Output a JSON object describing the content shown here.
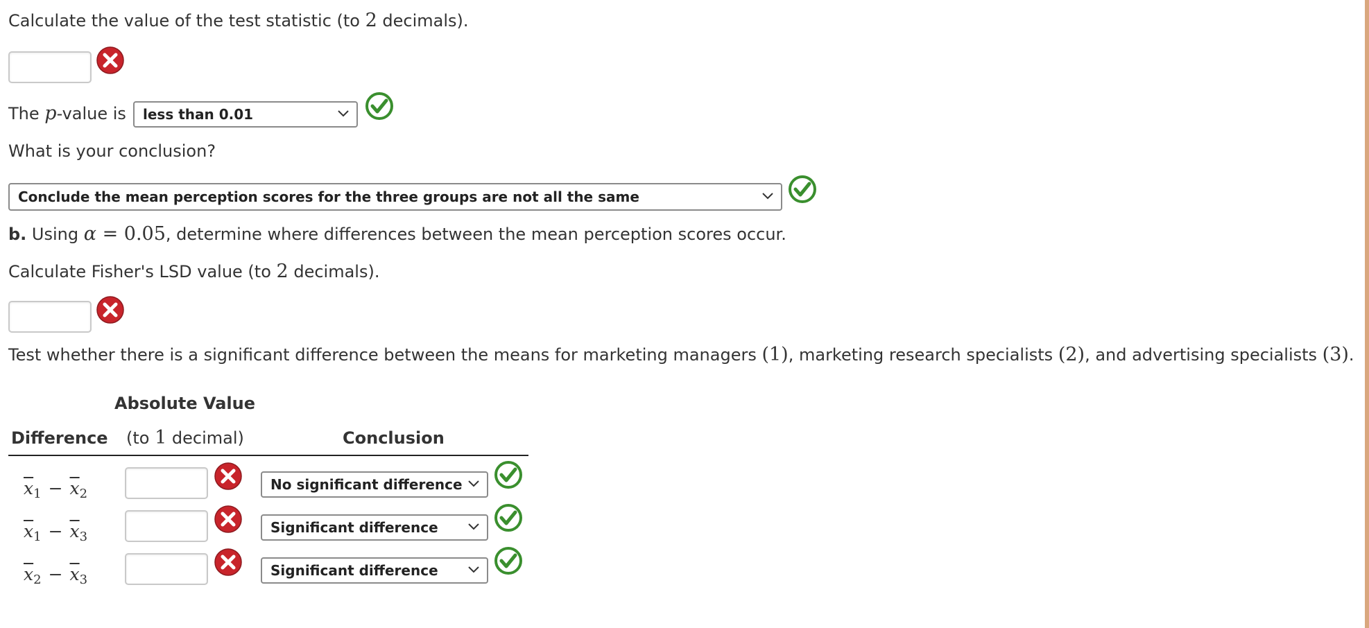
{
  "q_test_stat": {
    "prefix": "Calculate the value of the test statistic (to ",
    "num": "2",
    "suffix": " decimals).",
    "input_value": "",
    "status": "incorrect"
  },
  "p_value": {
    "prefix": "The ",
    "var": "p",
    "suffix": "-value is",
    "selected": "less than 0.01",
    "status": "correct"
  },
  "conclusion": {
    "prompt": "What is your conclusion?",
    "selected": "Conclude the mean perception scores for the three groups are not all the same",
    "status": "correct"
  },
  "part_b": {
    "label": "b.",
    "t1": " Using ",
    "alpha": "α",
    "eq": " = ",
    "alpha_val": "0.05",
    "t2": ", determine where differences between the mean perception scores occur."
  },
  "lsd": {
    "prefix": "Calculate Fisher's LSD value (to ",
    "num": "2",
    "suffix": " decimals).",
    "input_value": "",
    "status": "incorrect"
  },
  "test_instruction": {
    "t1": "Test whether there is a significant difference between the means for marketing managers ",
    "n1": "(1)",
    "t2": ", marketing research specialists ",
    "n2": "(2)",
    "t3": ", and advertising specialists ",
    "n3": "(3)",
    "t4": "."
  },
  "table": {
    "header_absolute": "Absolute Value",
    "header_difference": "Difference",
    "header_decimal_prefix": "(to ",
    "header_decimal_num": "1",
    "header_decimal_suffix": " decimal)",
    "header_conclusion": "Conclusion",
    "rows": [
      {
        "a": "x",
        "ai": "1",
        "b": "x",
        "bi": "2",
        "minus": "−",
        "input_value": "",
        "input_status": "incorrect",
        "selected": "No significant difference",
        "select_status": "correct"
      },
      {
        "a": "x",
        "ai": "1",
        "b": "x",
        "bi": "3",
        "minus": "−",
        "input_value": "",
        "input_status": "incorrect",
        "selected": "Significant difference",
        "select_status": "correct"
      },
      {
        "a": "x",
        "ai": "2",
        "b": "x",
        "bi": "3",
        "minus": "−",
        "input_value": "",
        "input_status": "incorrect",
        "selected": "Significant difference",
        "select_status": "correct"
      }
    ]
  },
  "icons": {
    "incorrect": "x-circle-icon",
    "correct": "check-circle-icon"
  },
  "colors": {
    "incorrect_red": "#c8242b",
    "correct_green": "#3a8f2e",
    "border_accent": "#d9a77e"
  }
}
